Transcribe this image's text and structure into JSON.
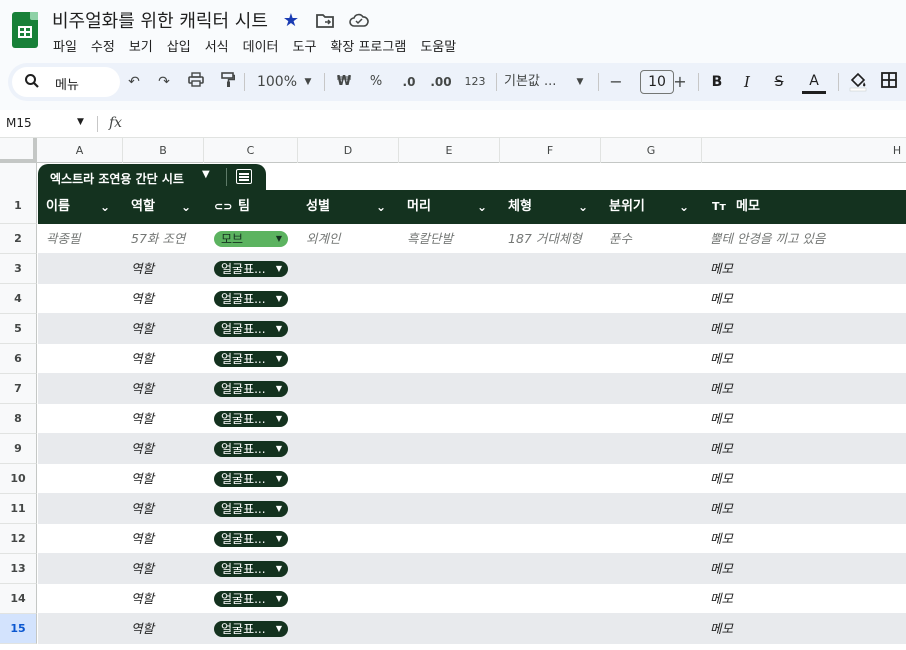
{
  "doc": {
    "title": "비주얼화를 위한 캐릭터 시트",
    "menu": [
      "파일",
      "수정",
      "보기",
      "삽입",
      "서식",
      "데이터",
      "도구",
      "확장 프로그램",
      "도움말"
    ]
  },
  "toolbar": {
    "search_label": "메뉴",
    "zoom": "100%",
    "currency": "₩",
    "percent": "%",
    "dec_decrease": ".0",
    "dec_increase": ".00",
    "number_format": "123",
    "font": "기본값 ...",
    "font_size": "10",
    "minus": "−",
    "plus": "+",
    "bold": "B",
    "italic": "I",
    "strike": "S",
    "text_color": "A"
  },
  "formula": {
    "name_box": "M15",
    "fx": "fx"
  },
  "columns": [
    "A",
    "B",
    "C",
    "D",
    "E",
    "F",
    "G",
    "H"
  ],
  "table": {
    "name": "엑스트라 조연용 간단 시트",
    "headers": [
      "이름",
      "역할",
      "팀",
      "성별",
      "머리",
      "체형",
      "분위기",
      "메모"
    ],
    "rows": [
      {
        "num": "1",
        "name": "",
        "role": "",
        "team": "",
        "gender": "",
        "hair": "",
        "body": "",
        "mood": "",
        "memo": ""
      },
      {
        "num": "2",
        "name": "곽종필",
        "role": "57화 조연",
        "team": "모브",
        "gender": "외계인",
        "hair": "흑칼단발",
        "body": "187 거대체형",
        "mood": "푼수",
        "memo": "뿔테 안경을 끼고 있음"
      },
      {
        "num": "3",
        "name": "",
        "role": "역할",
        "team": "얼굴표...",
        "gender": "",
        "hair": "",
        "body": "",
        "mood": "",
        "memo": "메모"
      },
      {
        "num": "4",
        "name": "",
        "role": "역할",
        "team": "얼굴표...",
        "gender": "",
        "hair": "",
        "body": "",
        "mood": "",
        "memo": "메모"
      },
      {
        "num": "5",
        "name": "",
        "role": "역할",
        "team": "얼굴표...",
        "gender": "",
        "hair": "",
        "body": "",
        "mood": "",
        "memo": "메모"
      },
      {
        "num": "6",
        "name": "",
        "role": "역할",
        "team": "얼굴표...",
        "gender": "",
        "hair": "",
        "body": "",
        "mood": "",
        "memo": "메모"
      },
      {
        "num": "7",
        "name": "",
        "role": "역할",
        "team": "얼굴표...",
        "gender": "",
        "hair": "",
        "body": "",
        "mood": "",
        "memo": "메모"
      },
      {
        "num": "8",
        "name": "",
        "role": "역할",
        "team": "얼굴표...",
        "gender": "",
        "hair": "",
        "body": "",
        "mood": "",
        "memo": "메모"
      },
      {
        "num": "9",
        "name": "",
        "role": "역할",
        "team": "얼굴표...",
        "gender": "",
        "hair": "",
        "body": "",
        "mood": "",
        "memo": "메모"
      },
      {
        "num": "10",
        "name": "",
        "role": "역할",
        "team": "얼굴표...",
        "gender": "",
        "hair": "",
        "body": "",
        "mood": "",
        "memo": "메모"
      },
      {
        "num": "11",
        "name": "",
        "role": "역할",
        "team": "얼굴표...",
        "gender": "",
        "hair": "",
        "body": "",
        "mood": "",
        "memo": "메모"
      },
      {
        "num": "12",
        "name": "",
        "role": "역할",
        "team": "얼굴표...",
        "gender": "",
        "hair": "",
        "body": "",
        "mood": "",
        "memo": "메모"
      },
      {
        "num": "13",
        "name": "",
        "role": "역할",
        "team": "얼굴표...",
        "gender": "",
        "hair": "",
        "body": "",
        "mood": "",
        "memo": "메모"
      },
      {
        "num": "14",
        "name": "",
        "role": "역할",
        "team": "얼굴표...",
        "gender": "",
        "hair": "",
        "body": "",
        "mood": "",
        "memo": "메모"
      },
      {
        "num": "15",
        "name": "",
        "role": "역할",
        "team": "얼굴표...",
        "gender": "",
        "hair": "",
        "body": "",
        "mood": "",
        "memo": "메모"
      }
    ]
  },
  "colors": {
    "table_header": "#14321f",
    "chip_dark": "#14321f",
    "chip_green": "#5cb360",
    "selected_row": "#d3e3fd",
    "brand": "#188038"
  },
  "icons": {
    "star": "star-icon",
    "folder": "move-folder-icon",
    "cloud": "cloud-status-icon",
    "search": "search-icon",
    "undo": "undo-icon",
    "redo": "redo-icon",
    "print": "print-icon",
    "paint_format": "paint-format-icon",
    "fill": "fill-color-icon",
    "borders": "borders-icon",
    "calendar": "table-options-icon"
  }
}
